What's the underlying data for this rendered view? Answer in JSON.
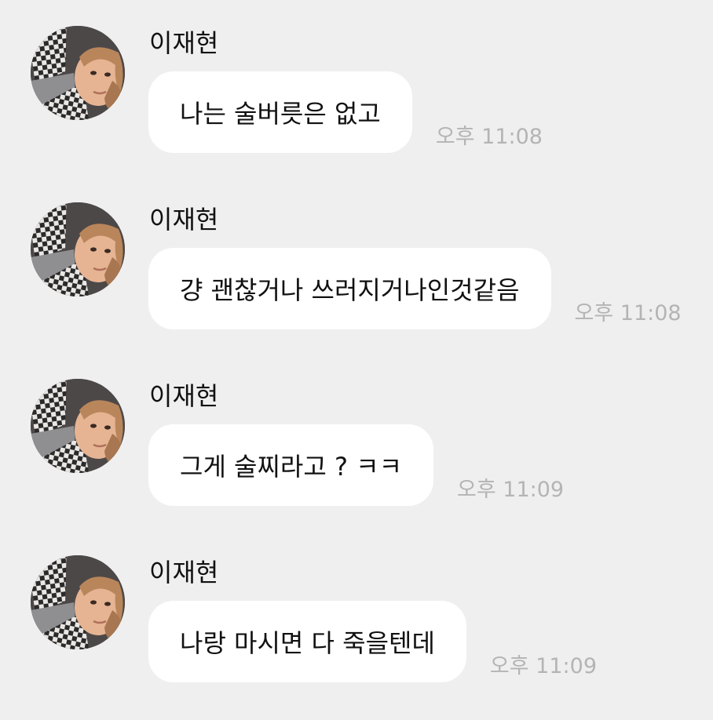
{
  "messages": [
    {
      "sender": "이재현",
      "text": "나는 술버릇은 없고",
      "time": "오후 11:08"
    },
    {
      "sender": "이재현",
      "text": "걍 괜찮거나 쓰러지거나인것같음",
      "time": "오후 11:08"
    },
    {
      "sender": "이재현",
      "text": "그게 술찌라고 ? ㅋㅋ",
      "time": "오후 11:09"
    },
    {
      "sender": "이재현",
      "text": "나랑 마시면 다 죽을텐데",
      "time": "오후 11:09"
    }
  ],
  "colors": {
    "background": "#efefef",
    "bubble": "#ffffff",
    "text": "#111111",
    "time": "#b4b4b4"
  },
  "icons": {
    "avatar": "profile-photo-avatar"
  }
}
